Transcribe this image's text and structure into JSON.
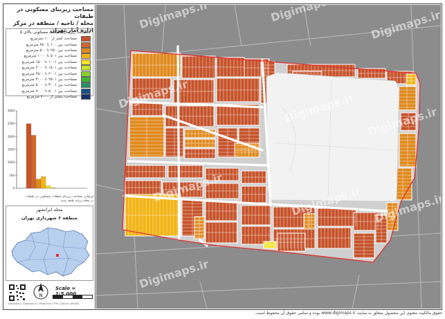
{
  "header": {
    "title_line1": "مساحت زیربنای مسکونی در طبقات",
    "title_line2": "محله / ناحیه / منطقه در مرکز اداره آمار تهران"
  },
  "legend": {
    "heading": "مساحت زیربنای قطعات مسکونی بالای ۵",
    "items": [
      {
        "label": "مساحت کمتر از ۱۰۰ مترمربع",
        "color": "#c6532b"
      },
      {
        "label": "مساحت بین ۱۰۰ تا ۲۵۰ مترمربع",
        "color": "#d2672a"
      },
      {
        "label": "مساحت بین ۲۵۰ تا ۵۰۰ مترمربع",
        "color": "#e08a1e"
      },
      {
        "label": "مساحت بین ۵۰۱ تا ۱۰۰۰ مترمربع",
        "color": "#f2b313"
      },
      {
        "label": "مساحت بین ۱۰۰۱ تا ۱۵۰۰ مترمربع",
        "color": "#f5e12a"
      },
      {
        "label": "مساحت بین ۱۵۰۱ تا ۲۰۰۰ مترمربع",
        "color": "#c8e22a"
      },
      {
        "label": "مساحت بین ۲۰۰۱ تا ۲۵۰۰ مترمربع",
        "color": "#8ad22e"
      },
      {
        "label": "مساحت بین ۲۵۰۱ تا ۳۰۰۰ مترمربع",
        "color": "#3db52f"
      },
      {
        "label": "مساحت بین ۳۰۰۱ تا ۵۰۰۰ مترمربع",
        "color": "#2a8f6a"
      },
      {
        "label": "مساحت بین ۵۰۰۱ تا ۷۰۰۰ مترمربع",
        "color": "#1d4f8a"
      },
      {
        "label": "مساحت بیشتر از ۷۰۰۰ مترمربع",
        "color": "#16306e"
      }
    ]
  },
  "chart_data": {
    "type": "bar",
    "title": "",
    "xlabel": "",
    "ylabel": "",
    "categories": [
      "1",
      "2",
      "3",
      "4",
      "5",
      "6",
      "7",
      "8",
      "9",
      "10",
      "11"
    ],
    "values": [
      2500,
      2050,
      350,
      450,
      100,
      25,
      0,
      0,
      0,
      0,
      0
    ],
    "colors": [
      "#c6532b",
      "#d2672a",
      "#e08a1e",
      "#f2b313",
      "#f5e12a",
      "#c8e22a",
      "#8ad22e",
      "#3db52f",
      "#2a8f6a",
      "#1d4f8a",
      "#16306e"
    ],
    "ylim": [
      0,
      3000
    ],
    "yticks": [
      "0",
      "500",
      "1000",
      "1500",
      "2000",
      "2500",
      "3000"
    ],
    "grid": false,
    "caption_line1": "فراوانی مساحت زیربنای قطعات مسکونی در طبقات",
    "caption_line2": "در محله برپایه طبقه بندی"
  },
  "location": {
    "label1": "محله ایرانشهر",
    "label2": "منطقه ۶ شهرداری تهران"
  },
  "bottom": {
    "scale": "Scale = 1:5,000",
    "north": "N",
    "credit": "Geocoding : Digimaps.ir | Projection: UTM | Datum: WGS84"
  },
  "watermarks": [
    "Digimaps.ir",
    "Digimaps.ir",
    "Digimaps.ir",
    "Digimaps.ir",
    "Digimaps.ir",
    "Digimaps.ir",
    "Digimaps.ir",
    "Digimaps.ir",
    "Digimaps.ir",
    "Digimaps.ir"
  ],
  "footer": {
    "text": "حقوق مالکیت معنوی این محصول متعلق به سایت www.digimaps.ir بوده و تمامی حقوق آن محفوظ است."
  },
  "colors": {
    "parcel_small": "#c6532b",
    "parcel_mid": "#d2672a",
    "parcel_orange": "#e08a1e",
    "parcel_yellow": "#f2b313",
    "parcel_bright": "#f5e12a",
    "boundary": "#e03030",
    "park": "#f2f2f2"
  }
}
